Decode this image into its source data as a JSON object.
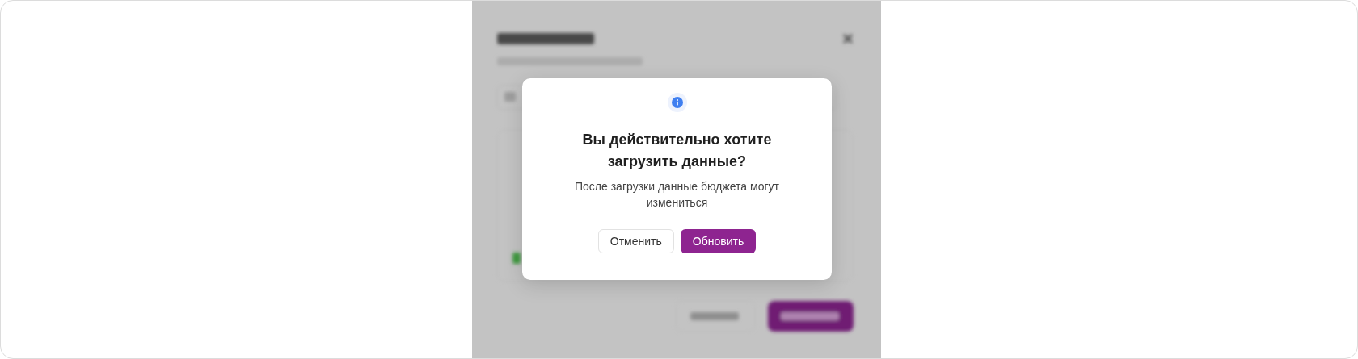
{
  "confirm_dialog": {
    "title": "Вы действительно хотите загрузить данные?",
    "message": "После загрузки данные бюджета могут измениться",
    "buttons": [
      {
        "label": "Отменить",
        "kind": "secondary"
      },
      {
        "label": "Обновить",
        "kind": "primary"
      }
    ]
  }
}
